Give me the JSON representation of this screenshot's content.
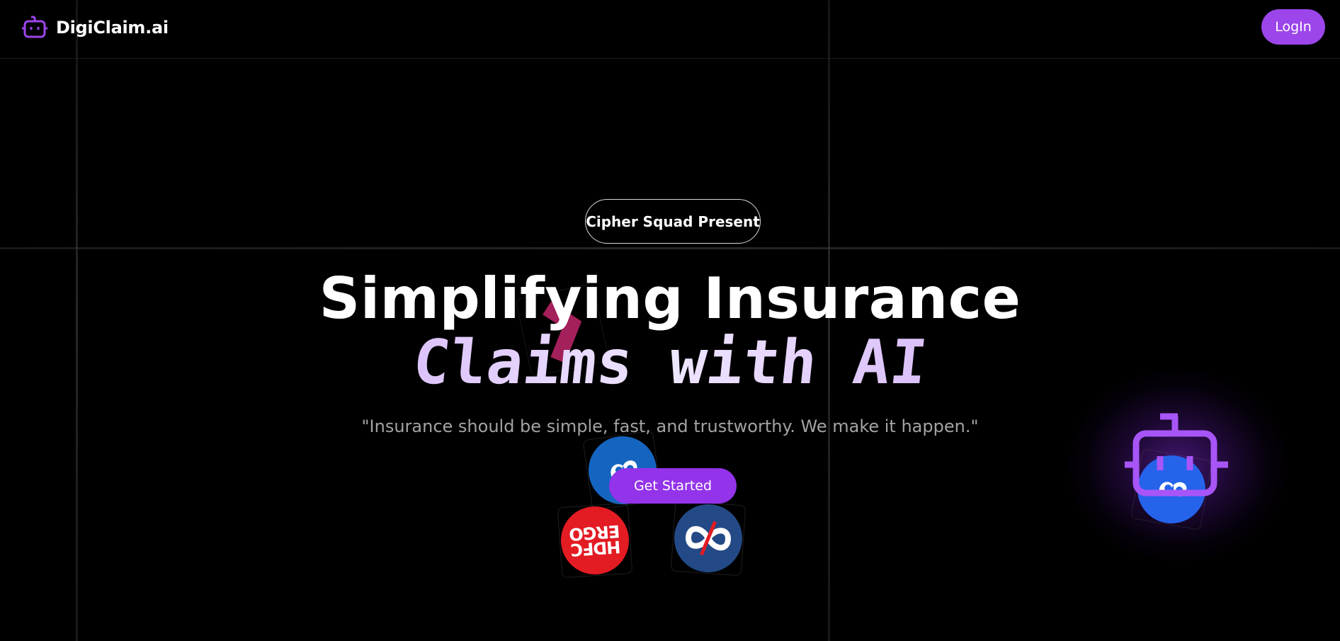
{
  "navbar": {
    "brand_name": "DigiClaim.ai",
    "login_label": "LogIn",
    "accent_color": "#9b45ea"
  },
  "hero": {
    "badge": "Cipher Squad Present",
    "title_line_1": "Simplifying Insurance",
    "title_line_2": "Claims with AI",
    "tagline": "\"Insurance should be simple, fast, and trustworthy. We make it happen.\"",
    "cta_label": "Get Started"
  },
  "logos": {
    "hdfc_line_1": "HDFC",
    "hdfc_line_2": "ERGO",
    "items": [
      "bajaj-logo",
      "hdfc-ergo-logo",
      "infinity-logo",
      "robot-icon"
    ]
  },
  "colors": {
    "background": "#000000",
    "cta": "#9333ea",
    "hdfc_red": "#e31b23",
    "bajaj_blue": "#1565c0",
    "navy": "#234a86"
  }
}
